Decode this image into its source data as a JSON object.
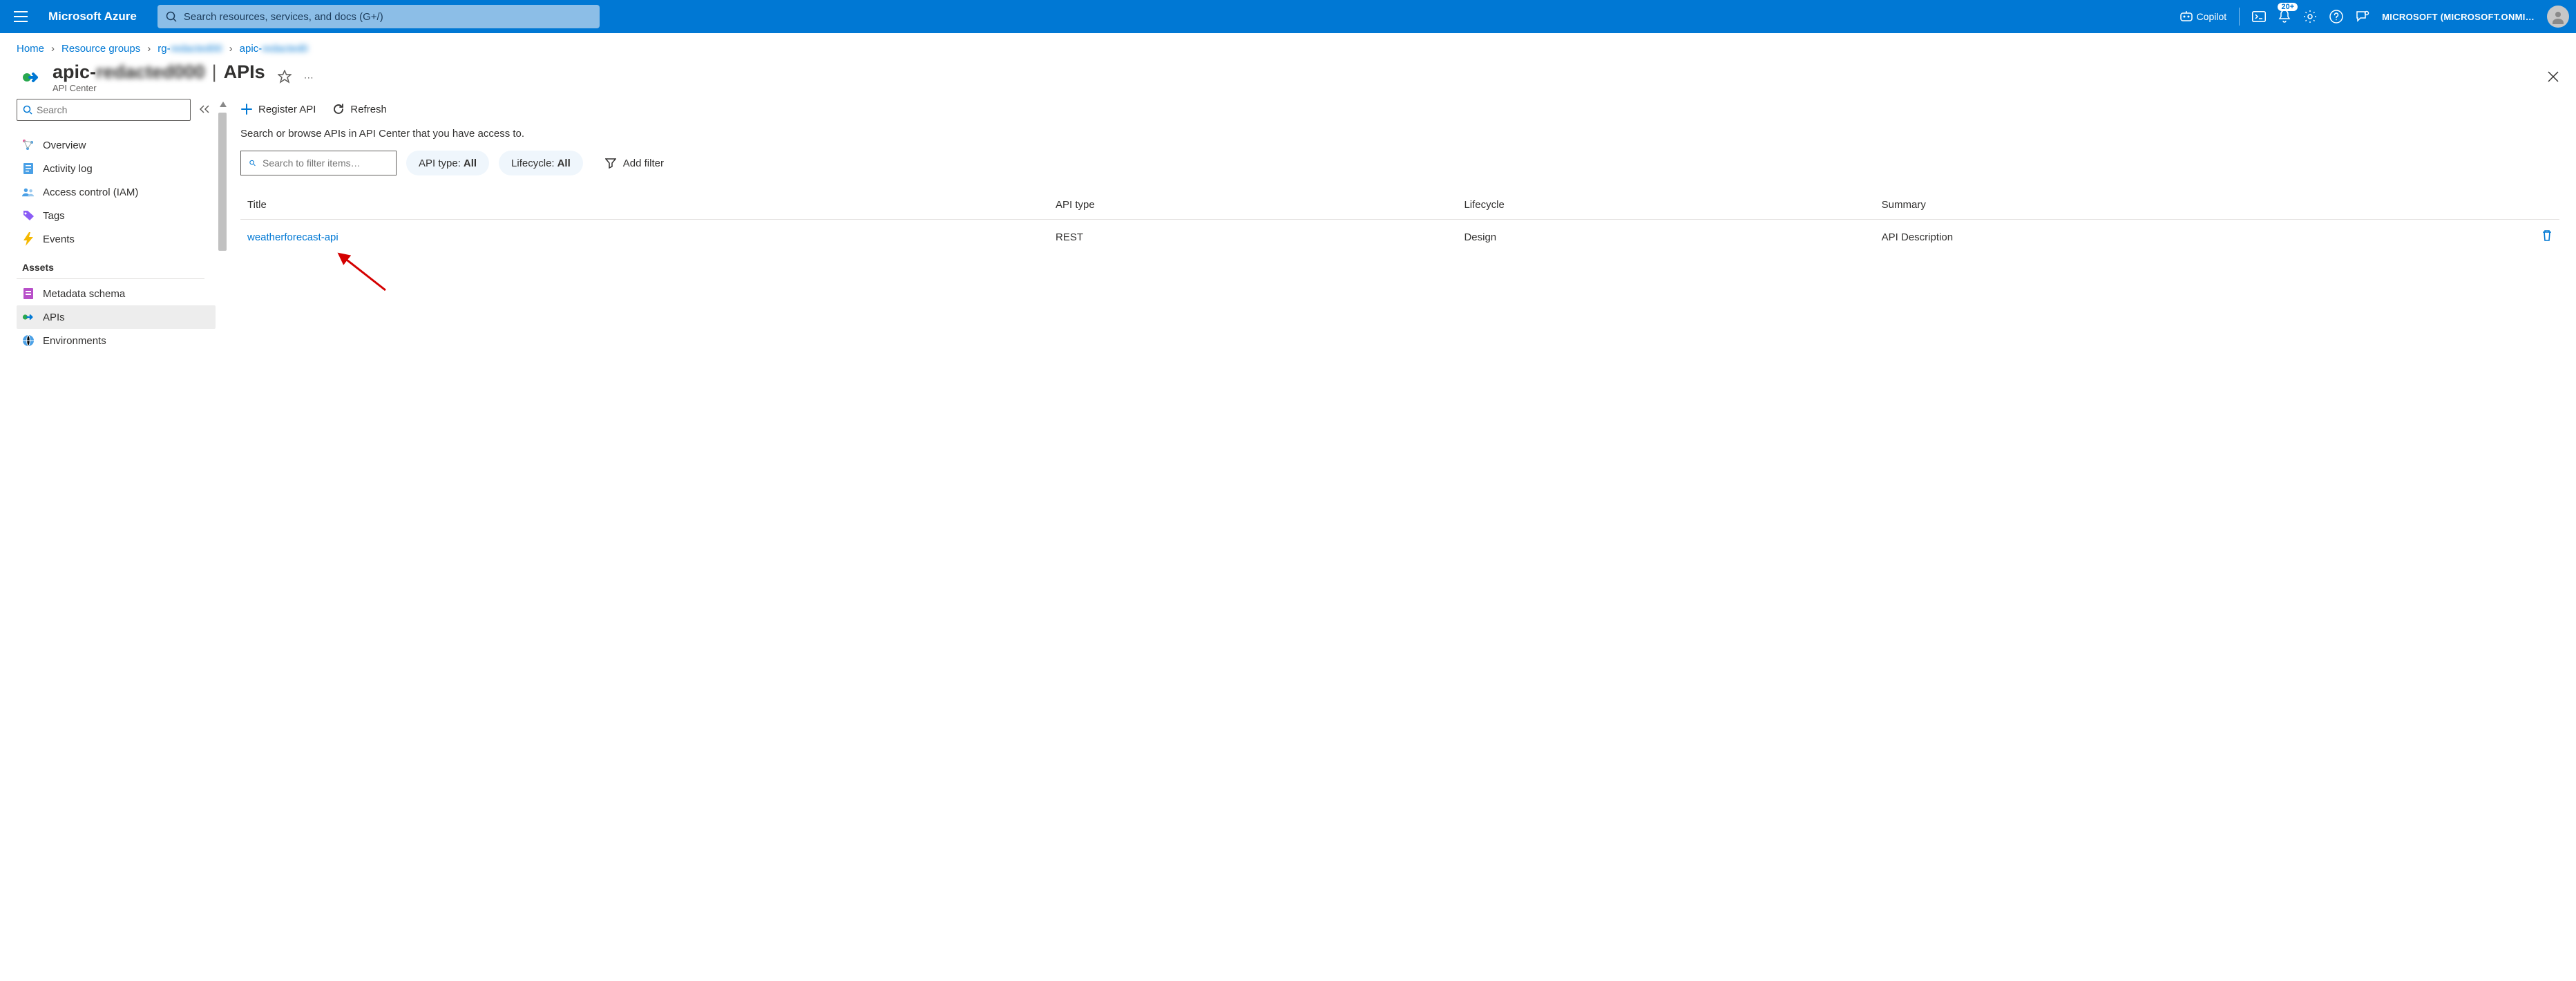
{
  "topbar": {
    "brand": "Microsoft Azure",
    "search_placeholder": "Search resources, services, and docs (G+/)",
    "copilot": "Copilot",
    "notification_badge": "20+",
    "account": "MICROSOFT (MICROSOFT.ONMI…"
  },
  "breadcrumb": {
    "items": [
      "Home",
      "Resource groups",
      "rg-██████████",
      "apic-██████████"
    ]
  },
  "header": {
    "resource_name": "apic-██████████",
    "section": "APIs",
    "service": "API Center"
  },
  "sidebar": {
    "search_placeholder": "Search",
    "items_top": [
      {
        "label": "Overview",
        "icon": "overview-icon"
      },
      {
        "label": "Activity log",
        "icon": "activitylog-icon"
      },
      {
        "label": "Access control (IAM)",
        "icon": "accesscontrol-icon"
      },
      {
        "label": "Tags",
        "icon": "tags-icon"
      },
      {
        "label": "Events",
        "icon": "events-icon"
      }
    ],
    "section_assets": "Assets",
    "items_assets": [
      {
        "label": "Metadata schema",
        "icon": "metadata-icon"
      },
      {
        "label": "APIs",
        "icon": "apis-icon",
        "active": true
      },
      {
        "label": "Environments",
        "icon": "environments-icon"
      }
    ]
  },
  "toolbar": {
    "register_label": "Register API",
    "refresh_label": "Refresh"
  },
  "main": {
    "description": "Search or browse APIs in API Center that you have access to.",
    "filter_search_placeholder": "Search to filter items…",
    "filters": [
      {
        "label": "API type",
        "value": "All"
      },
      {
        "label": "Lifecycle",
        "value": "All"
      }
    ],
    "add_filter_label": "Add filter",
    "columns": [
      "Title",
      "API type",
      "Lifecycle",
      "Summary"
    ],
    "rows": [
      {
        "title": "weatherforecast-api",
        "api_type": "REST",
        "lifecycle": "Design",
        "summary": "API Description"
      }
    ]
  }
}
